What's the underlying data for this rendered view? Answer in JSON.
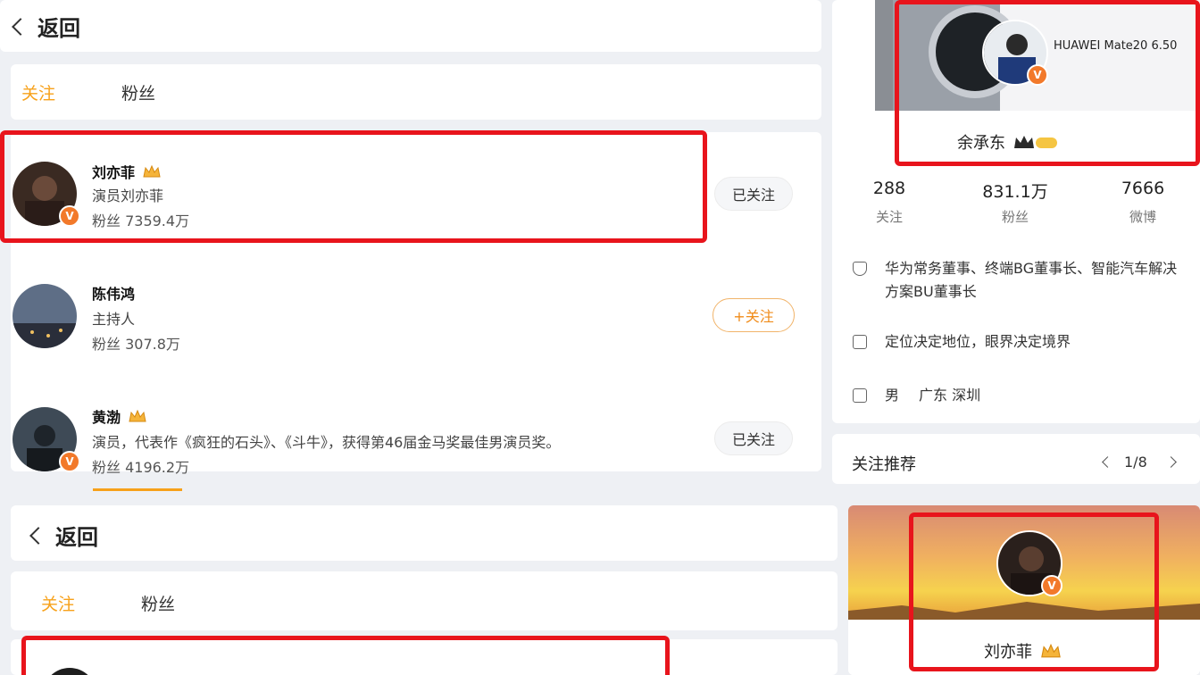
{
  "top": {
    "back_label": "返回",
    "tabs": [
      {
        "label": "关注"
      },
      {
        "label": "粉丝"
      }
    ],
    "users": [
      {
        "name": "刘亦菲",
        "desc": "演员刘亦菲",
        "fans": "粉丝 7359.4万",
        "button": "已关注"
      },
      {
        "name": "陈伟鸿",
        "desc": "主持人",
        "fans": "粉丝 307.8万",
        "button": "+关注"
      },
      {
        "name": "黄渤",
        "desc": "演员，代表作《疯狂的石头》、《斗牛》，获得第46届金马奖最佳男演员奖。",
        "fans": "粉丝 4196.2万",
        "button": "已关注"
      }
    ]
  },
  "profile": {
    "banner_text": "HUAWEI Mate20 6.50",
    "name": "余承东",
    "stats": [
      {
        "value": "288",
        "label": "关注"
      },
      {
        "value": "831.1万",
        "label": "粉丝"
      },
      {
        "value": "7666",
        "label": "微博"
      }
    ],
    "bio": "华为常务董事、终端BG董事长、智能汽车解决方案BU董事长",
    "motto": "定位决定地位，眼界决定境界",
    "gender": "男",
    "location": "广东 深圳"
  },
  "recommend": {
    "title": "关注推荐",
    "page": "1/8"
  },
  "bottom": {
    "back_label": "返回",
    "tabs": [
      {
        "label": "关注"
      },
      {
        "label": "粉丝"
      }
    ],
    "card_name": "刘亦菲"
  },
  "colors": {
    "accent": "#f7a11a",
    "highlight": "#e8141c",
    "verified": "#f2792a"
  }
}
